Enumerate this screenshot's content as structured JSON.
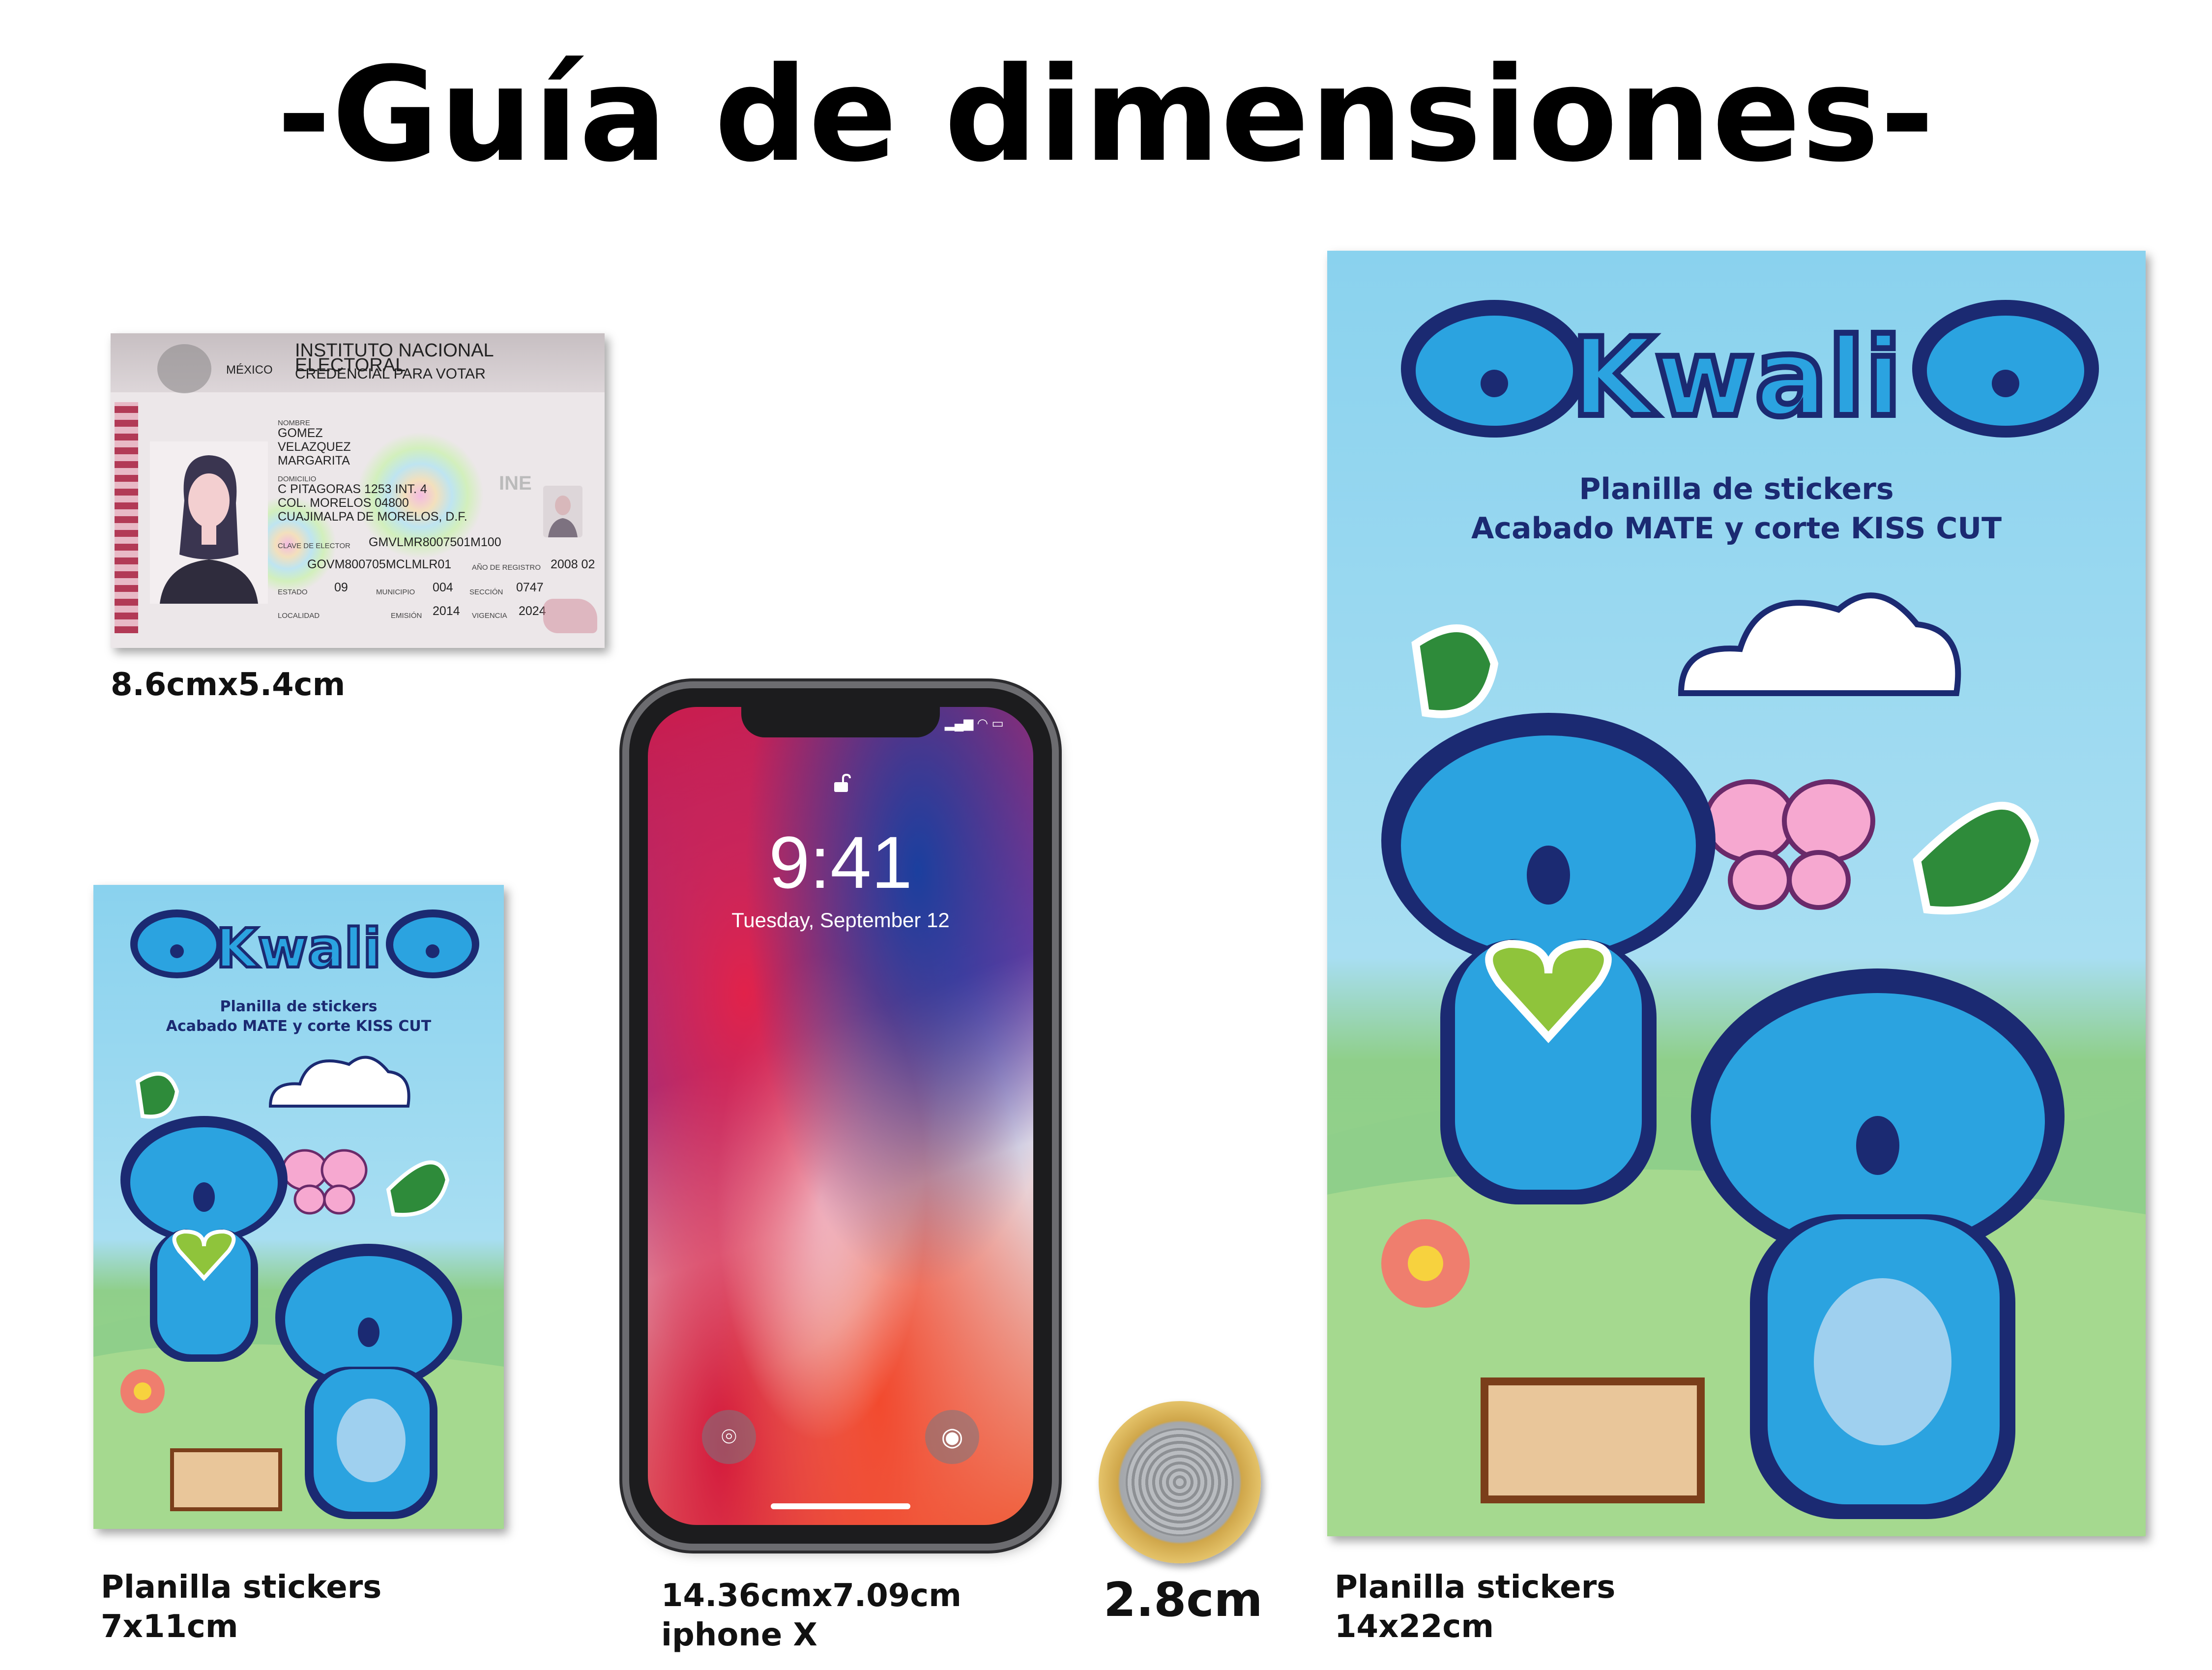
{
  "title": "-Guía de dimensiones-",
  "id_card": {
    "country": "MÉXICO",
    "institute": "INSTITUTO NACIONAL ELECTORAL",
    "doc": "CREDENCIAL PARA VOTAR",
    "nombre_label": "NOMBRE",
    "name": [
      "GOMEZ",
      "VELAZQUEZ",
      "MARGARITA"
    ],
    "domicilio_label": "DOMICILIO",
    "address": [
      "C PITAGORAS 1253 INT. 4",
      "COL. MORELOS 04800",
      "CUAJIMALPA DE MORELOS, D.F."
    ],
    "clave_label": "CLAVE DE ELECTOR",
    "clave": "GMVLMR8007501M100",
    "curp": "GOVM800705MCLMLR01",
    "registro_label": "AÑO DE REGISTRO",
    "registro": "2008 02",
    "estado_label": "ESTADO",
    "estado": "09",
    "municipio_label": "MUNICIPIO",
    "municipio": "004",
    "seccion_label": "SECCIÓN",
    "seccion": "0747",
    "localidad_label": "LOCALIDAD",
    "emision_label": "EMISIÓN",
    "emision": "2014",
    "vigencia_label": "VIGENCIA",
    "vigencia": "2024",
    "ine_mark": "INE",
    "caption": "8.6cmx5.4cm"
  },
  "small_sheet": {
    "brand": "Kwali",
    "line1": "Planilla de stickers",
    "line2": "Acabado MATE y corte KISS CUT",
    "caption_line1": "Planilla stickers",
    "caption_line2": "7x11cm"
  },
  "phone": {
    "time": "9:41",
    "date": "Tuesday, September 12",
    "caption_line1": "14.36cmx7.09cm",
    "caption_line2": "iphone X"
  },
  "coin": {
    "caption": "2.8cm"
  },
  "large_sheet": {
    "brand": "Kwali",
    "line1": "Planilla de stickers",
    "line2": "Acabado MATE y corte KISS CUT",
    "caption_line1": "Planilla stickers",
    "caption_line2": "14x22cm"
  },
  "colors": {
    "koala": "#2ba3e0",
    "koala_outline": "#1b2a72",
    "sky": "#8ad2ee",
    "grass": "#9ed48e",
    "heart": "#8fc43b",
    "leaf": "#2e8b3a"
  }
}
